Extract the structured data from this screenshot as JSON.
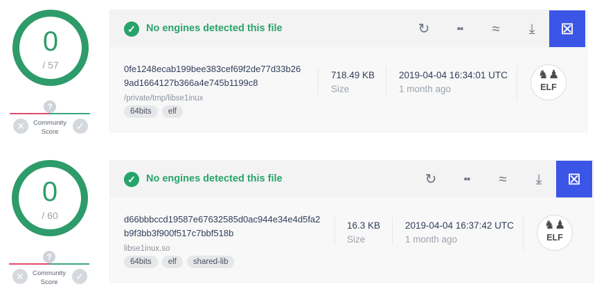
{
  "results": [
    {
      "score": {
        "detected": "0",
        "total": "/ 57"
      },
      "community": {
        "label_line1": "Community",
        "label_line2": "Score",
        "question": "?"
      },
      "status": "No engines detected this file",
      "hash_line1": "0fe1248ecab199bee383cef69f2de77d33b26",
      "hash_line2": "9ad1664127b366a4e745b1199c8",
      "path": "/private/tmp/libse1inux",
      "tags": [
        "64bits",
        "elf"
      ],
      "size_value": "718.49 KB",
      "size_label": "Size",
      "date_value": "2019-04-04 16:34:01 UTC",
      "date_relative": "1 month ago",
      "filetype": "ELF"
    },
    {
      "score": {
        "detected": "0",
        "total": "/ 60"
      },
      "community": {
        "label_line1": "Community",
        "label_line2": "Score",
        "question": "?"
      },
      "status": "No engines detected this file",
      "hash_line1": "d66bbbccd19587e67632585d0ac944e34e4d5fa2",
      "hash_line2": "b9f3bb3f900f517c7bbf518b",
      "path": "libse1inux.so",
      "tags": [
        "64bits",
        "elf",
        "shared-lib"
      ],
      "size_value": "16.3 KB",
      "size_label": "Size",
      "date_value": "2019-04-04 16:37:42 UTC",
      "date_relative": "1 month ago",
      "filetype": "ELF"
    }
  ],
  "toolbar_icons": [
    "reanalyze-icon",
    "similar-icon",
    "approximate-icon",
    "download-icon",
    "graph-icon"
  ],
  "colors": {
    "accent_green": "#28a36b",
    "gauge_green": "#2e9c6a",
    "active_blue": "#3b55e6",
    "community_red": "#e04a6b"
  }
}
